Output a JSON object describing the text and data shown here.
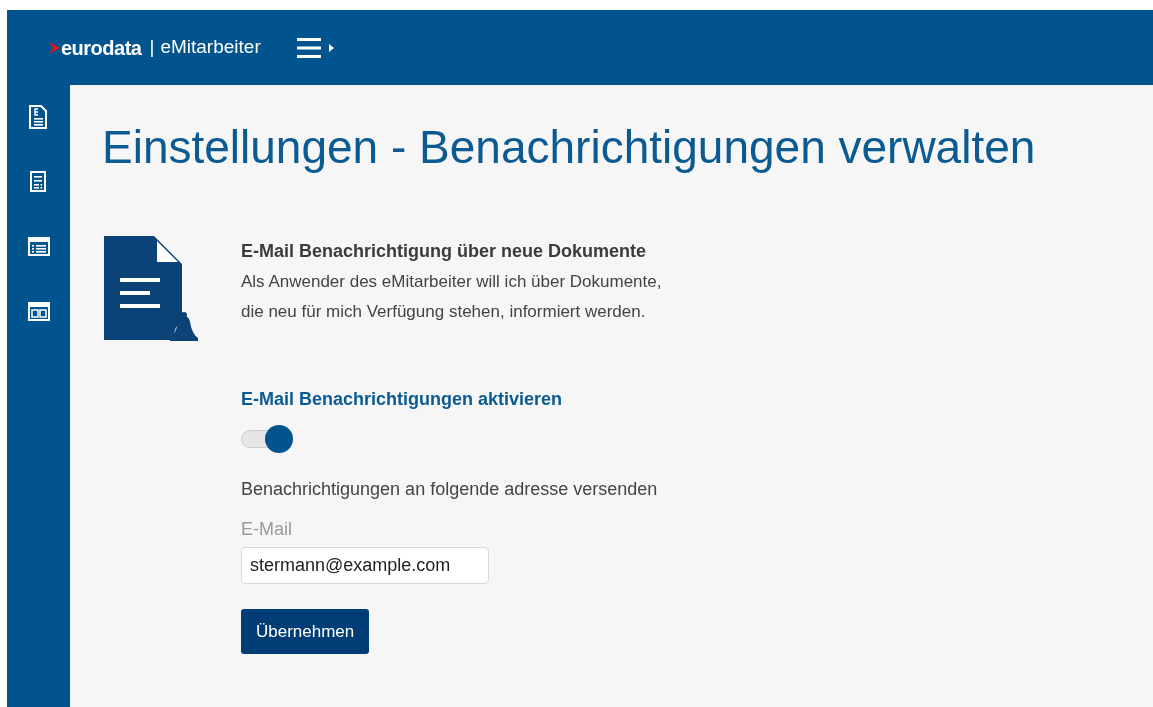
{
  "header": {
    "brand": "eurodata",
    "app": "eMitarbeiter",
    "separator": "|"
  },
  "sidebar": {
    "items": [
      {
        "kind": "invoice"
      },
      {
        "kind": "form"
      },
      {
        "kind": "list"
      },
      {
        "kind": "calendar"
      }
    ]
  },
  "page": {
    "title": "Einstellungen - Benachrichtigungen verwalten"
  },
  "setting": {
    "heading": "E-Mail Benachrichtigung über neue Dokumente",
    "description_lines": [
      "Als Anwender des eMitarbeiter will ich über Dokumente,",
      "die neu für mich Verfügung stehen, informiert werden."
    ],
    "toggle_label": "E-Mail Benachrichtigungen aktivieren",
    "toggle": {
      "on": true
    },
    "address_hint": "Benachrichtigungen an folgende adresse versenden",
    "email": {
      "label": "E-Mail",
      "value": "stermann@example.com"
    },
    "button": "Übernehmen"
  }
}
